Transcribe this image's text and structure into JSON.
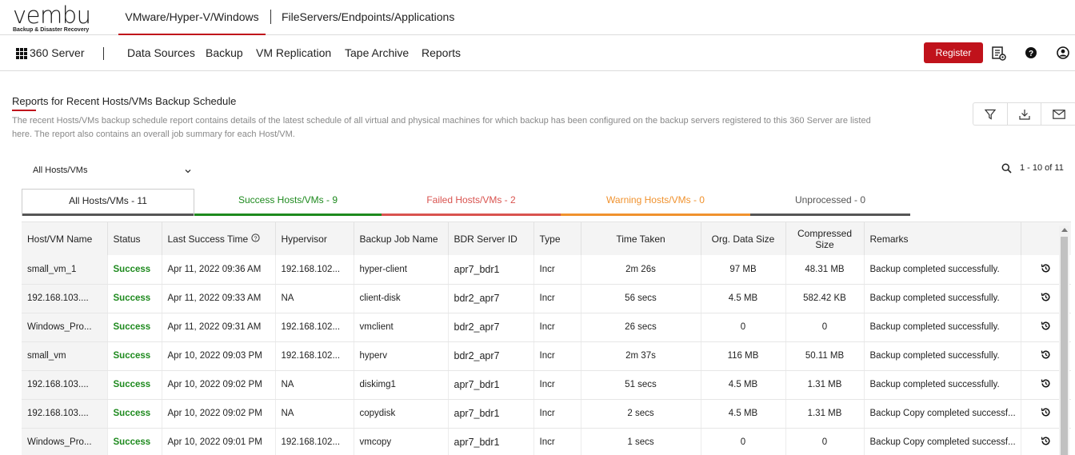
{
  "brand": {
    "logo": "vembu",
    "tagline": "Backup & Disaster Recovery"
  },
  "top_tabs": [
    {
      "label": "VMware/Hyper-V/Windows",
      "active": true
    },
    {
      "label": "FileServers/Endpoints/Applications",
      "active": false
    }
  ],
  "nav": {
    "home": "360 Server",
    "items": [
      "Data Sources",
      "Backup",
      "VM Replication",
      "Tape Archive",
      "Reports"
    ],
    "register": "Register",
    "icons": [
      "settings-list-icon",
      "help-icon",
      "user-icon"
    ]
  },
  "colors": {
    "brand_red": "#c0121b",
    "success": "#1e8a1e",
    "failed": "#d9534f",
    "warning": "#f0922e",
    "unprocessed": "#555555"
  },
  "report": {
    "title": "Reports for Recent Hosts/VMs Backup Schedule",
    "description": "The recent Hosts/VMs backup schedule report contains details of the latest schedule of all virtual and physical machines for which backup has been configured on the backup servers registered to this 360 Server are listed here. The report also contains an overall job summary for each Host/VM.",
    "actions": [
      "filter-icon",
      "download-icon",
      "mail-icon"
    ]
  },
  "filter": {
    "selected": "All Hosts/VMs"
  },
  "pager": "1 - 10 of 11",
  "stat_tabs": [
    {
      "label": "All Hosts/VMs - 11"
    },
    {
      "label": "Success Hosts/VMs - 9"
    },
    {
      "label": "Failed Hosts/VMs - 2"
    },
    {
      "label": "Warning Hosts/VMs - 0"
    },
    {
      "label": "Unprocessed - 0"
    }
  ],
  "table": {
    "headers": [
      "Host/VM Name",
      "Status",
      "Last Success Time",
      "Hypervisor",
      "Backup Job Name",
      "BDR Server ID",
      "Type",
      "Time Taken",
      "Org. Data Size",
      "Compressed Size",
      "Remarks"
    ],
    "rows": [
      [
        "small_vm_1",
        "Success",
        "Apr 11, 2022 09:36 AM",
        "192.168.102...",
        "hyper-client",
        "apr7_bdr1",
        "Incr",
        "2m 26s",
        "97 MB",
        "48.31 MB",
        "Backup completed successfully."
      ],
      [
        "192.168.103....",
        "Success",
        "Apr 11, 2022 09:33 AM",
        "NA",
        "client-disk",
        "bdr2_apr7",
        "Incr",
        "56 secs",
        "4.5 MB",
        "582.42 KB",
        "Backup completed successfully."
      ],
      [
        "Windows_Pro...",
        "Success",
        "Apr 11, 2022 09:31 AM",
        "192.168.102...",
        "vmclient",
        "bdr2_apr7",
        "Incr",
        "26 secs",
        "0",
        "0",
        "Backup completed successfully."
      ],
      [
        "small_vm",
        "Success",
        "Apr 10, 2022 09:03 PM",
        "192.168.102...",
        "hyperv",
        "bdr2_apr7",
        "Incr",
        "2m 37s",
        "116 MB",
        "50.11 MB",
        "Backup completed successfully."
      ],
      [
        "192.168.103....",
        "Success",
        "Apr 10, 2022 09:02 PM",
        "NA",
        "diskimg1",
        "apr7_bdr1",
        "Incr",
        "51 secs",
        "4.5 MB",
        "1.31 MB",
        "Backup completed successfully."
      ],
      [
        "192.168.103....",
        "Success",
        "Apr 10, 2022 09:02 PM",
        "NA",
        "copydisk",
        "apr7_bdr1",
        "Incr",
        "2 secs",
        "4.5 MB",
        "1.31 MB",
        "Backup Copy completed successf..."
      ],
      [
        "Windows_Pro...",
        "Success",
        "Apr 10, 2022 09:01 PM",
        "192.168.102...",
        "vmcopy",
        "apr7_bdr1",
        "Incr",
        "1 secs",
        "0",
        "0",
        "Backup Copy completed successf..."
      ]
    ]
  }
}
